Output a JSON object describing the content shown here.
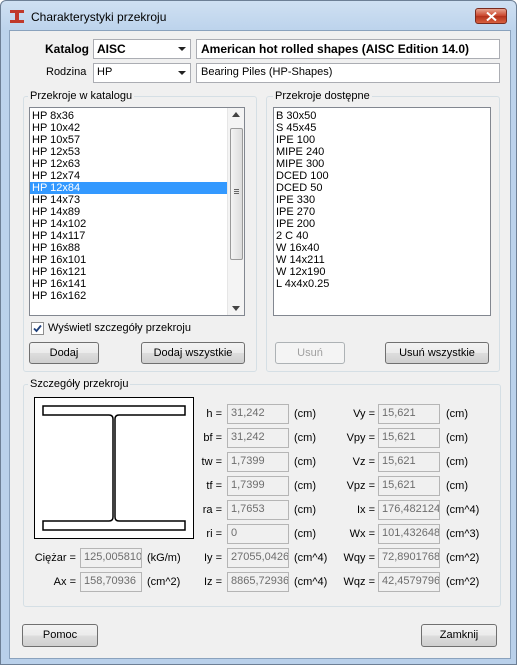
{
  "window": {
    "title": "Charakterystyki przekroju"
  },
  "catalog": {
    "label": "Katalog",
    "value": "AISC",
    "description": "American hot rolled shapes (AISC Edition 14.0)"
  },
  "family": {
    "label": "Rodzina",
    "value": "HP",
    "description": "Bearing Piles (HP-Shapes)"
  },
  "catalog_sections": {
    "title": "Przekroje w katalogu",
    "items": [
      "HP 8x36",
      "HP 10x42",
      "HP 10x57",
      "HP 12x53",
      "HP 12x63",
      "HP 12x74",
      "HP 12x84",
      "HP 14x73",
      "HP 14x89",
      "HP 14x102",
      "HP 14x117",
      "HP 16x88",
      "HP 16x101",
      "HP 16x121",
      "HP 16x141",
      "HP 16x162"
    ],
    "selected_index": 6,
    "show_details_label": "Wyświetl szczegóły przekroju",
    "show_details_checked": true,
    "add_label": "Dodaj",
    "add_all_label": "Dodaj wszystkie"
  },
  "available_sections": {
    "title": "Przekroje dostępne",
    "items": [
      "B 30x50",
      "S 45x45",
      "IPE 100",
      "MIPE 240",
      "MIPE 300",
      "DCED 100",
      "DCED 50",
      "IPE 330",
      "IPE 270",
      "IPE 200",
      "2 C 40",
      "W 16x40",
      "W 14x211",
      "W 12x190",
      "L 4x4x0.25"
    ],
    "remove_label": "Usuń",
    "remove_all_label": "Usuń wszystkie"
  },
  "details": {
    "title": "Szczegóły przekroju",
    "mass": {
      "label": "Ciężar =",
      "value": "125,005810",
      "unit": "(kG/m)"
    },
    "area": {
      "label": "Ax =",
      "value": "158,70936",
      "unit": "(cm^2)"
    },
    "left_params": [
      {
        "label": "h =",
        "value": "31,242",
        "unit": "(cm)"
      },
      {
        "label": "bf =",
        "value": "31,242",
        "unit": "(cm)"
      },
      {
        "label": "tw =",
        "value": "1,7399",
        "unit": "(cm)"
      },
      {
        "label": "tf =",
        "value": "1,7399",
        "unit": "(cm)"
      },
      {
        "label": "ra =",
        "value": "1,7653",
        "unit": "(cm)"
      },
      {
        "label": "ri =",
        "value": "0",
        "unit": "(cm)"
      },
      {
        "label": "Iy =",
        "value": "27055,0426",
        "unit": "(cm^4)"
      },
      {
        "label": "Iz =",
        "value": "8865,72936",
        "unit": "(cm^4)"
      }
    ],
    "right_params": [
      {
        "label": "Vy =",
        "value": "15,621",
        "unit": "(cm)"
      },
      {
        "label": "Vpy =",
        "value": "15,621",
        "unit": "(cm)"
      },
      {
        "label": "Vz =",
        "value": "15,621",
        "unit": "(cm)"
      },
      {
        "label": "Vpz =",
        "value": "15,621",
        "unit": "(cm)"
      },
      {
        "label": "Ix =",
        "value": "176,482124",
        "unit": "(cm^4)"
      },
      {
        "label": "Wx =",
        "value": "101,432648",
        "unit": "(cm^3)"
      },
      {
        "label": "Wqy =",
        "value": "72,8901768",
        "unit": "(cm^2)"
      },
      {
        "label": "Wqz =",
        "value": "42,4579796",
        "unit": "(cm^2)"
      }
    ]
  },
  "footer": {
    "help_label": "Pomoc",
    "close_label": "Zamknij"
  },
  "colors": {
    "selection": "#3399ff",
    "window_frame": "#b9d0ea",
    "dialog_bg": "#f0f0f0",
    "close_button": "#c9432b"
  }
}
